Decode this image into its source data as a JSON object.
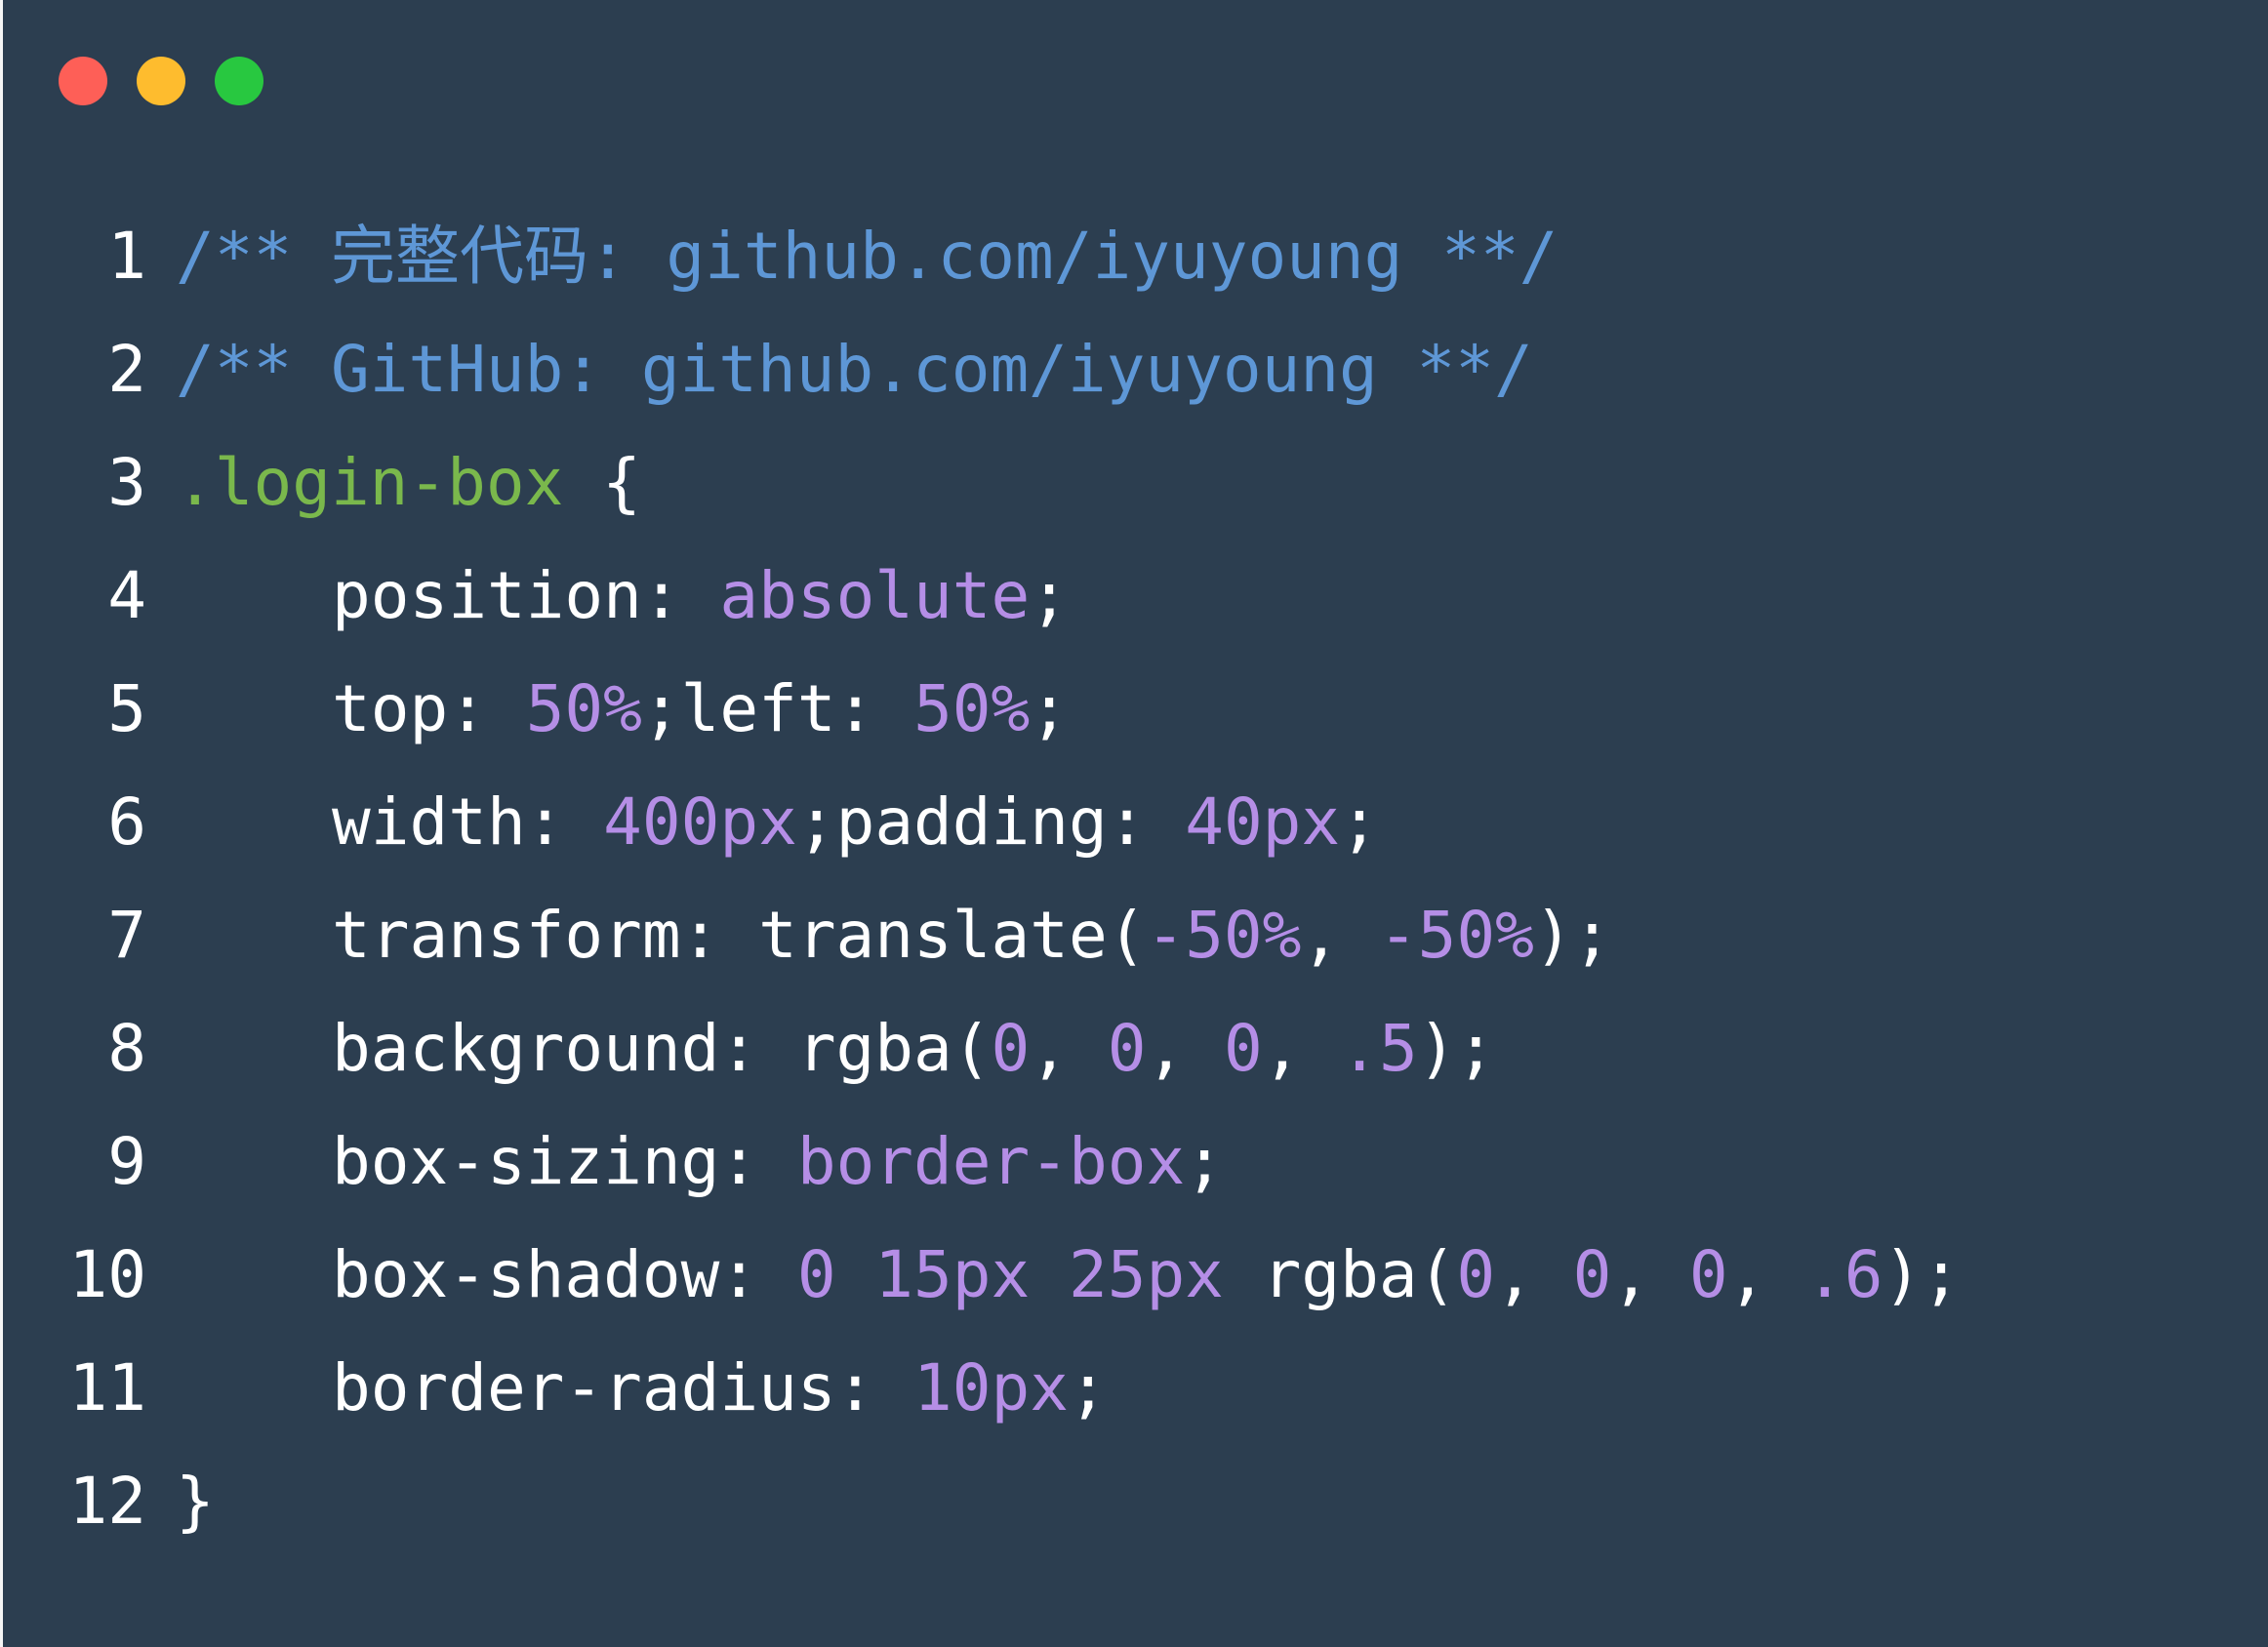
{
  "window": {
    "background": "#2c3e50",
    "controls": [
      {
        "name": "close",
        "color": "#fe5f57"
      },
      {
        "name": "minimize",
        "color": "#febc2e"
      },
      {
        "name": "maximize",
        "color": "#28c840"
      }
    ]
  },
  "colors": {
    "comment": "#5e97d6",
    "selector": "#7ab84c",
    "value": "#b58ee6",
    "text": "#ffffff"
  },
  "code": {
    "language": "css",
    "lines": [
      {
        "number": "1",
        "indent": false,
        "tokens": [
          {
            "type": "comment",
            "text": "/** 完整代码: github.com/iyuyoung **/"
          }
        ]
      },
      {
        "number": "2",
        "indent": false,
        "tokens": [
          {
            "type": "comment",
            "text": "/** GitHub: github.com/iyuyoung **/"
          }
        ]
      },
      {
        "number": "3",
        "indent": false,
        "tokens": [
          {
            "type": "selector",
            "text": ".login-box"
          },
          {
            "type": "plain",
            "text": " {"
          }
        ]
      },
      {
        "number": "4",
        "indent": true,
        "tokens": [
          {
            "type": "prop",
            "text": "position: "
          },
          {
            "type": "value",
            "text": "absolute"
          },
          {
            "type": "plain",
            "text": ";"
          }
        ]
      },
      {
        "number": "5",
        "indent": true,
        "tokens": [
          {
            "type": "prop",
            "text": "top: "
          },
          {
            "type": "value",
            "text": "50%"
          },
          {
            "type": "plain",
            "text": ";left: "
          },
          {
            "type": "value",
            "text": "50%"
          },
          {
            "type": "plain",
            "text": ";"
          }
        ]
      },
      {
        "number": "6",
        "indent": true,
        "tokens": [
          {
            "type": "prop",
            "text": "width: "
          },
          {
            "type": "value",
            "text": "400px"
          },
          {
            "type": "plain",
            "text": ";padding: "
          },
          {
            "type": "value",
            "text": "40px"
          },
          {
            "type": "plain",
            "text": ";"
          }
        ]
      },
      {
        "number": "7",
        "indent": true,
        "tokens": [
          {
            "type": "prop",
            "text": "transform: translate("
          },
          {
            "type": "value",
            "text": "-50%"
          },
          {
            "type": "plain",
            "text": ", "
          },
          {
            "type": "value",
            "text": "-50%"
          },
          {
            "type": "plain",
            "text": ");"
          }
        ]
      },
      {
        "number": "8",
        "indent": true,
        "tokens": [
          {
            "type": "prop",
            "text": "background: rgba("
          },
          {
            "type": "value",
            "text": "0"
          },
          {
            "type": "plain",
            "text": ", "
          },
          {
            "type": "value",
            "text": "0"
          },
          {
            "type": "plain",
            "text": ", "
          },
          {
            "type": "value",
            "text": "0"
          },
          {
            "type": "plain",
            "text": ", "
          },
          {
            "type": "value",
            "text": ".5"
          },
          {
            "type": "plain",
            "text": ");"
          }
        ]
      },
      {
        "number": "9",
        "indent": true,
        "tokens": [
          {
            "type": "prop",
            "text": "box-sizing: "
          },
          {
            "type": "value",
            "text": "border-box"
          },
          {
            "type": "plain",
            "text": ";"
          }
        ]
      },
      {
        "number": "10",
        "indent": true,
        "tokens": [
          {
            "type": "prop",
            "text": "box-shadow: "
          },
          {
            "type": "value",
            "text": "0 15px 25px"
          },
          {
            "type": "plain",
            "text": " rgba("
          },
          {
            "type": "value",
            "text": "0"
          },
          {
            "type": "plain",
            "text": ", "
          },
          {
            "type": "value",
            "text": "0"
          },
          {
            "type": "plain",
            "text": ", "
          },
          {
            "type": "value",
            "text": "0"
          },
          {
            "type": "plain",
            "text": ", "
          },
          {
            "type": "value",
            "text": ".6"
          },
          {
            "type": "plain",
            "text": ");"
          }
        ]
      },
      {
        "number": "11",
        "indent": true,
        "tokens": [
          {
            "type": "prop",
            "text": "border-radius: "
          },
          {
            "type": "value",
            "text": "10px"
          },
          {
            "type": "plain",
            "text": ";"
          }
        ]
      },
      {
        "number": "12",
        "indent": false,
        "tokens": [
          {
            "type": "plain",
            "text": "}"
          }
        ]
      }
    ]
  }
}
